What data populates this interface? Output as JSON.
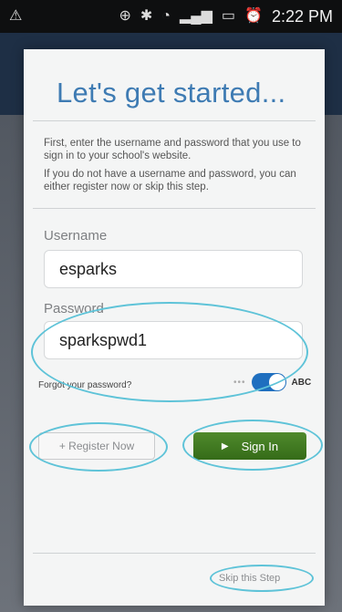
{
  "status_bar": {
    "left_icon": "warning-triangle-icon",
    "right_icons": [
      "gps-icon",
      "bluetooth-icon",
      "wifi-icon",
      "signal-icon",
      "battery-icon",
      "alarm-icon"
    ],
    "time": "2:22 PM"
  },
  "card": {
    "title": "Let's get started...",
    "intro_1": "First, enter the username and password that you use to sign in to your school's website.",
    "intro_2": "If you do not have a username and password, you can either register now or skip this step."
  },
  "form": {
    "username_label": "Username",
    "username_value": "esparks",
    "password_label": "Password",
    "password_value": "sparkspwd1",
    "forgot_link": "Forgot your password?",
    "toggle_dots": "•••",
    "toggle_label": "ABC"
  },
  "actions": {
    "register": "+ Register Now",
    "sign_in": "Sign In",
    "skip": "Skip this Step"
  },
  "colors": {
    "title": "#3e7bb3",
    "sign_in": "#3f7b22",
    "toggle": "#1f6fbf",
    "annotation": "#5ec3d8"
  }
}
